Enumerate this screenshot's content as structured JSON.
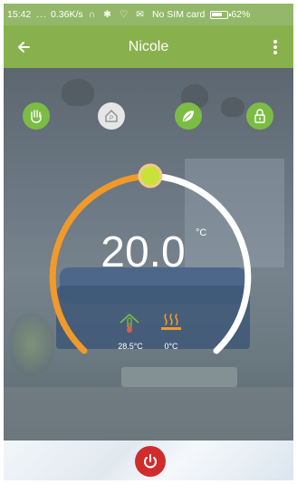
{
  "status_bar": {
    "time": "15:42",
    "dots": "...",
    "speed": "0.36K/s",
    "status_icons": "∩ ✱ ♡ ✉",
    "carrier": "No SIM card",
    "battery": "62%"
  },
  "header": {
    "title": "Nicole"
  },
  "modes": [
    "manual-mode",
    "program-mode",
    "eco-mode",
    "lock"
  ],
  "thermostat": {
    "set_temperature": "20.0",
    "unit": "°C",
    "room_temperature": "28.5°C",
    "floor_temperature": "0°C",
    "arc_colors": {
      "active": "#ef9a2a",
      "inactive": "#ffffff",
      "knob": "#c8e23a"
    }
  },
  "colors": {
    "header": "#88b14d",
    "status_bar": "#93b86a",
    "mode_active": "#7cbc45",
    "power": "#d12c2c"
  }
}
